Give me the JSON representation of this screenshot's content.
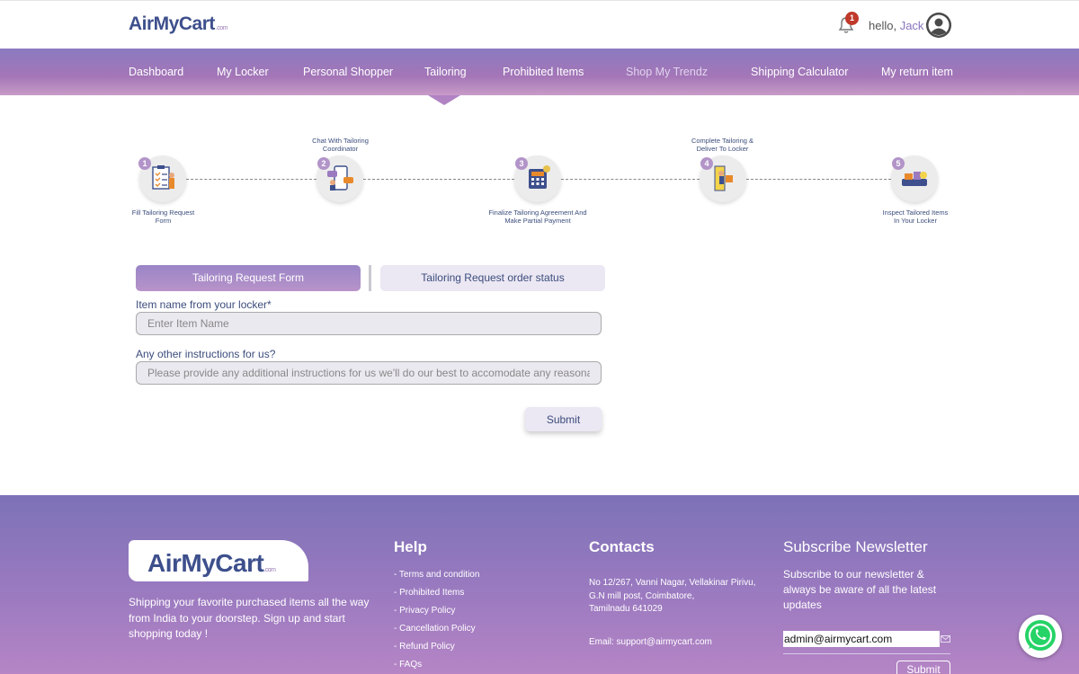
{
  "header": {
    "logo_main": "AirMyCart",
    "logo_domain": ".com",
    "notification_count": "1",
    "greeting": "hello,",
    "user_name": "Jack"
  },
  "nav": {
    "items": [
      "Dashboard",
      "My Locker",
      "Personal Shopper",
      "Tailoring",
      "Prohibited Items",
      "Shop My Trendz",
      "Shipping Calculator",
      "My return item"
    ],
    "active": "Tailoring"
  },
  "steps": [
    {
      "number": "1",
      "label_line1": "Fill Tailoring Request",
      "label_line2": "Form"
    },
    {
      "number": "2",
      "label_line1": "Chat With Tailoring",
      "label_line2": "Coordinator"
    },
    {
      "number": "3",
      "label_line1": "Finalize Tailoring Agreement And",
      "label_line2": "Make Partial Payment"
    },
    {
      "number": "4",
      "label_line1": "Complete Tailoring &",
      "label_line2": "Deliver To Locker"
    },
    {
      "number": "5",
      "label_line1": "Inspect Tailored Items",
      "label_line2": "In Your Locker"
    }
  ],
  "tabs": {
    "form": "Tailoring Request Form",
    "status": "Tailoring Request order status"
  },
  "form": {
    "item_label": "Item name from your locker*",
    "item_placeholder": "Enter Item Name",
    "instructions_label": "Any other instructions for us?",
    "instructions_placeholder": "Please provide any additional instructions for us we'll do our best to accomodate any reasonable requests",
    "submit": "Submit"
  },
  "footer": {
    "logo_main": "AirMyCart",
    "logo_domain": ".com",
    "description": "Shipping your favorite purchased items all the way from India to your doorstep. Sign up and start shopping today !",
    "help_title": "Help",
    "help_items": [
      "- Terms and condition",
      "- Prohibited Items",
      "- Privacy Policy",
      "- Cancellation Policy",
      "- Refund Policy",
      "- FAQs"
    ],
    "contacts_title": "Contacts",
    "address_line1": "No 12/267, Vanni Nagar, Vellakinar Pirivu,",
    "address_line2": "G.N mill post, Coimbatore,",
    "address_line3": "Tamilnadu 641029",
    "email": "Email: support@airmycart.com",
    "newsletter_title": "Subscribe Newsletter",
    "newsletter_text": "Subscribe to our newsletter & always be aware of all the latest updates",
    "newsletter_value": "admin@airmycart.com",
    "newsletter_submit": "Submit"
  },
  "colors": {
    "brand_purple": "#9b7ac0",
    "brand_navy": "#3d4f8c",
    "badge_red": "#c0392b"
  },
  "icons": [
    "bell-icon",
    "avatar-icon",
    "mail-icon",
    "whatsapp-icon"
  ]
}
